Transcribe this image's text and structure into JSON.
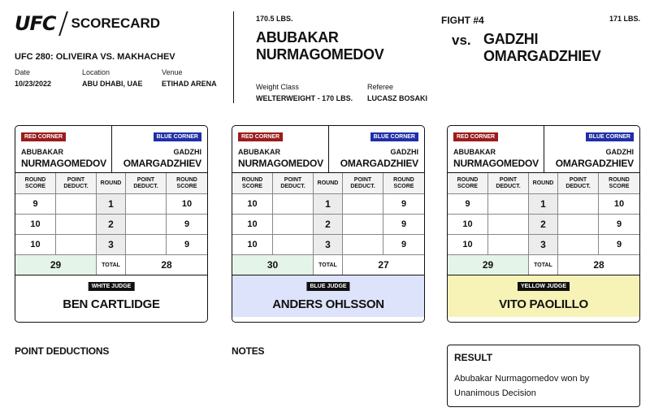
{
  "header": {
    "logo_text": "UFC",
    "scorecard_label": "SCORECARD",
    "event_title": "UFC 280: OLIVEIRA VS. MAKHACHEV",
    "date_label": "Date",
    "date_value": "10/23/2022",
    "location_label": "Location",
    "location_value": "ABU DHABI, UAE",
    "venue_label": "Venue",
    "venue_value": "ETIHAD ARENA"
  },
  "fight": {
    "number": "FIGHT #4",
    "vs": "vs.",
    "red_weight": "170.5 LBS.",
    "red_name_line1": "ABUBAKAR",
    "red_name_line2": "NURMAGOMEDOV",
    "blue_weight": "171 LBS.",
    "blue_name": "GADZHI OMARGADZHIEV",
    "weight_class_label": "Weight Class",
    "weight_class_value": "WELTERWEIGHT - 170 LBS.",
    "referee_label": "Referee",
    "referee_value": "LUCASZ BOSAKI"
  },
  "labels": {
    "red_corner": "RED CORNER",
    "blue_corner": "BLUE CORNER",
    "round_score": "ROUND SCORE",
    "point_deduct": "POINT DEDUCT.",
    "round": "ROUND",
    "total": "TOTAL"
  },
  "cards": [
    {
      "red_first": "ABUBAKAR",
      "red_last": "NURMAGOMEDOV",
      "blue_first": "GADZHI",
      "blue_last": "OMARGADZHIEV",
      "rows": [
        {
          "red_score": "9",
          "red_deduct": "",
          "round": "1",
          "blue_deduct": "",
          "blue_score": "10"
        },
        {
          "red_score": "10",
          "red_deduct": "",
          "round": "2",
          "blue_deduct": "",
          "blue_score": "9"
        },
        {
          "red_score": "10",
          "red_deduct": "",
          "round": "3",
          "blue_deduct": "",
          "blue_score": "9"
        }
      ],
      "red_total": "29",
      "blue_total": "28",
      "judge_badge": "WHITE JUDGE",
      "judge_name": "BEN CARTLIDGE",
      "judge_color": "#ffffff"
    },
    {
      "red_first": "ABUBAKAR",
      "red_last": "NURMAGOMEDOV",
      "blue_first": "GADZHI",
      "blue_last": "OMARGADZHIEV",
      "rows": [
        {
          "red_score": "10",
          "red_deduct": "",
          "round": "1",
          "blue_deduct": "",
          "blue_score": "9"
        },
        {
          "red_score": "10",
          "red_deduct": "",
          "round": "2",
          "blue_deduct": "",
          "blue_score": "9"
        },
        {
          "red_score": "10",
          "red_deduct": "",
          "round": "3",
          "blue_deduct": "",
          "blue_score": "9"
        }
      ],
      "red_total": "30",
      "blue_total": "27",
      "judge_badge": "BLUE JUDGE",
      "judge_name": "ANDERS OHLSSON",
      "judge_color": "#dde3fa"
    },
    {
      "red_first": "ABUBAKAR",
      "red_last": "NURMAGOMEDOV",
      "blue_first": "GADZHI",
      "blue_last": "OMARGADZHIEV",
      "rows": [
        {
          "red_score": "9",
          "red_deduct": "",
          "round": "1",
          "blue_deduct": "",
          "blue_score": "10"
        },
        {
          "red_score": "10",
          "red_deduct": "",
          "round": "2",
          "blue_deduct": "",
          "blue_score": "9"
        },
        {
          "red_score": "10",
          "red_deduct": "",
          "round": "3",
          "blue_deduct": "",
          "blue_score": "9"
        }
      ],
      "red_total": "29",
      "blue_total": "28",
      "judge_badge": "YELLOW JUDGE",
      "judge_name": "VITO PAOLILLO",
      "judge_color": "#f7f3b6"
    }
  ],
  "footer": {
    "point_deductions_title": "POINT DEDUCTIONS",
    "notes_title": "NOTES",
    "result_title": "RESULT",
    "result_text": "Abubakar Nurmagomedov won by Unanimous Decision"
  },
  "colors": {
    "red_badge": "#9b1c1c",
    "blue_badge": "#1e2fa8",
    "red_total_bg": "#e4f4e8"
  }
}
